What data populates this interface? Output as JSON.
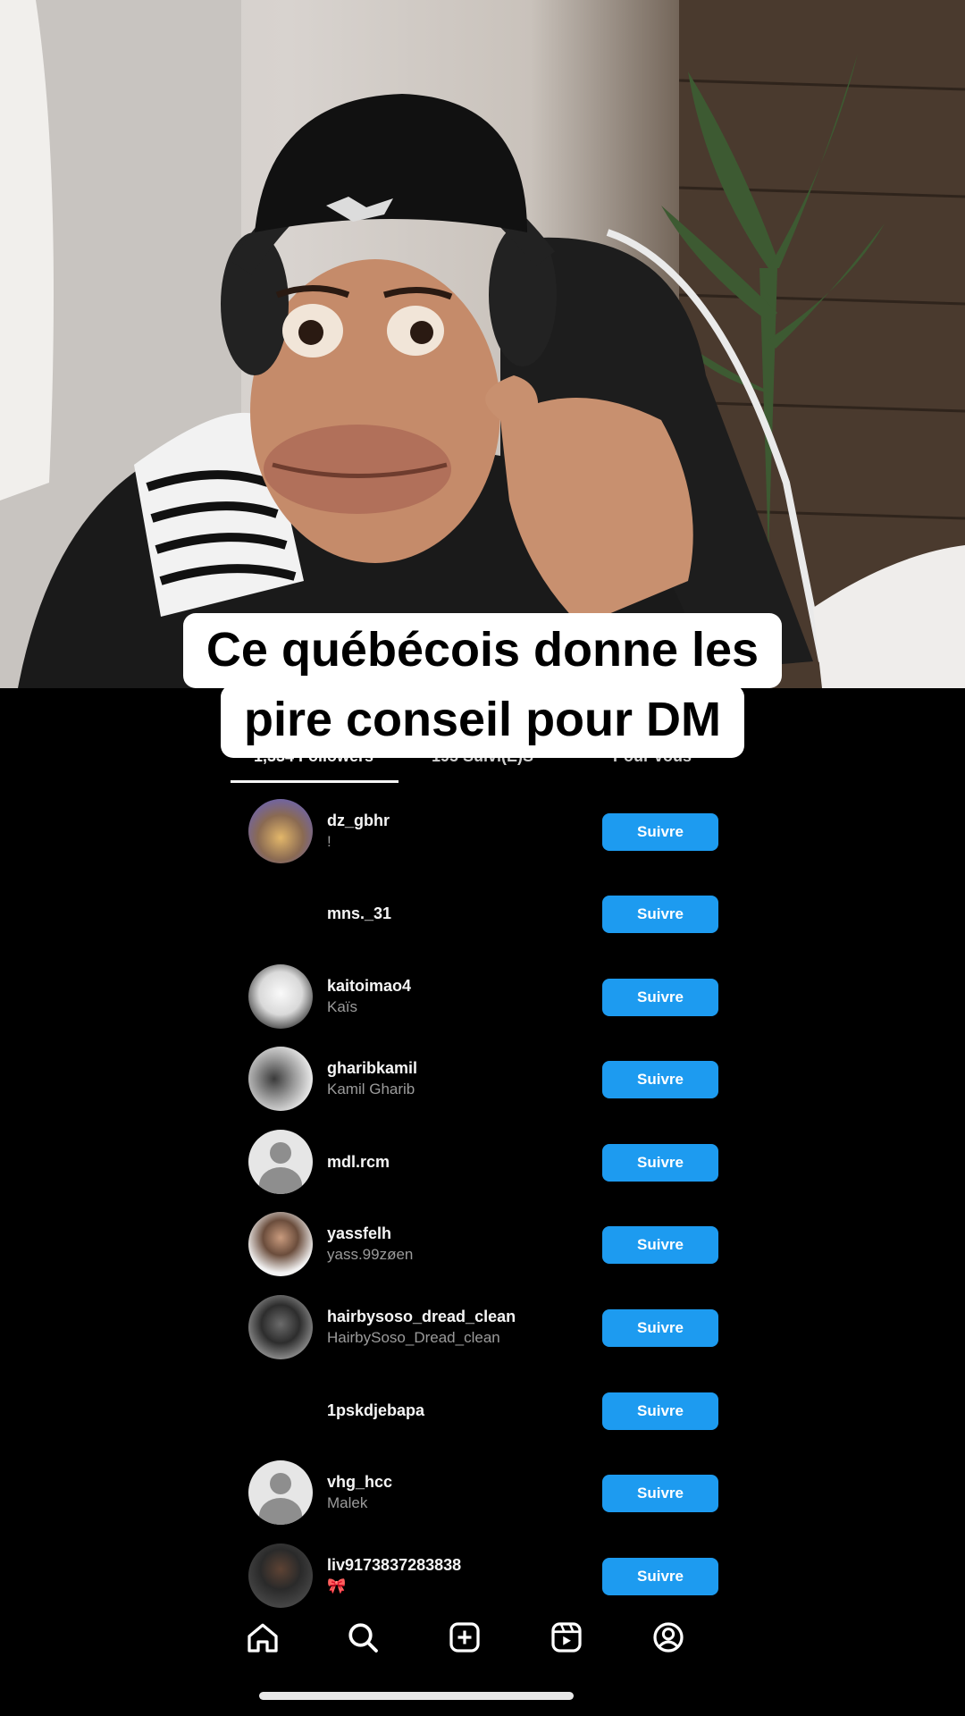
{
  "caption": {
    "line1": "Ce québécois donne les",
    "line2": "pire conseil pour DM"
  },
  "tabs": [
    {
      "label": "1,334 Followers",
      "active": true
    },
    {
      "label": "195 Suivi(E)S",
      "active": false
    },
    {
      "label": "Pour vous",
      "active": false
    }
  ],
  "follow_label": "Suivre",
  "accent_color": "#1d9bf0",
  "users": [
    {
      "username": "dz_gbhr",
      "fullname": "!",
      "avatar": "photo1"
    },
    {
      "username": "mns._31",
      "fullname": "",
      "avatar": "blank"
    },
    {
      "username": "kaitoimao4",
      "fullname": "Kaïs",
      "avatar": "photo2"
    },
    {
      "username": "gharibkamil",
      "fullname": "Kamil Gharib",
      "avatar": "photo3"
    },
    {
      "username": "mdl.rcm",
      "fullname": "",
      "avatar": "default"
    },
    {
      "username": "yassfelh",
      "fullname": "yass.99zøen",
      "avatar": "photo4"
    },
    {
      "username": "hairbysoso_dread_clean",
      "fullname": "HairbySoso_Dread_clean",
      "avatar": "photo5"
    },
    {
      "username": "1pskdjebapa",
      "fullname": "",
      "avatar": "blank"
    },
    {
      "username": "vhg_hcc",
      "fullname": "Malek",
      "avatar": "default"
    },
    {
      "username": "liv9173837283838",
      "fullname": "🎀",
      "avatar": "photo6"
    }
  ],
  "nav": [
    "home-icon",
    "search-icon",
    "create-icon",
    "reels-icon",
    "profile-icon"
  ]
}
